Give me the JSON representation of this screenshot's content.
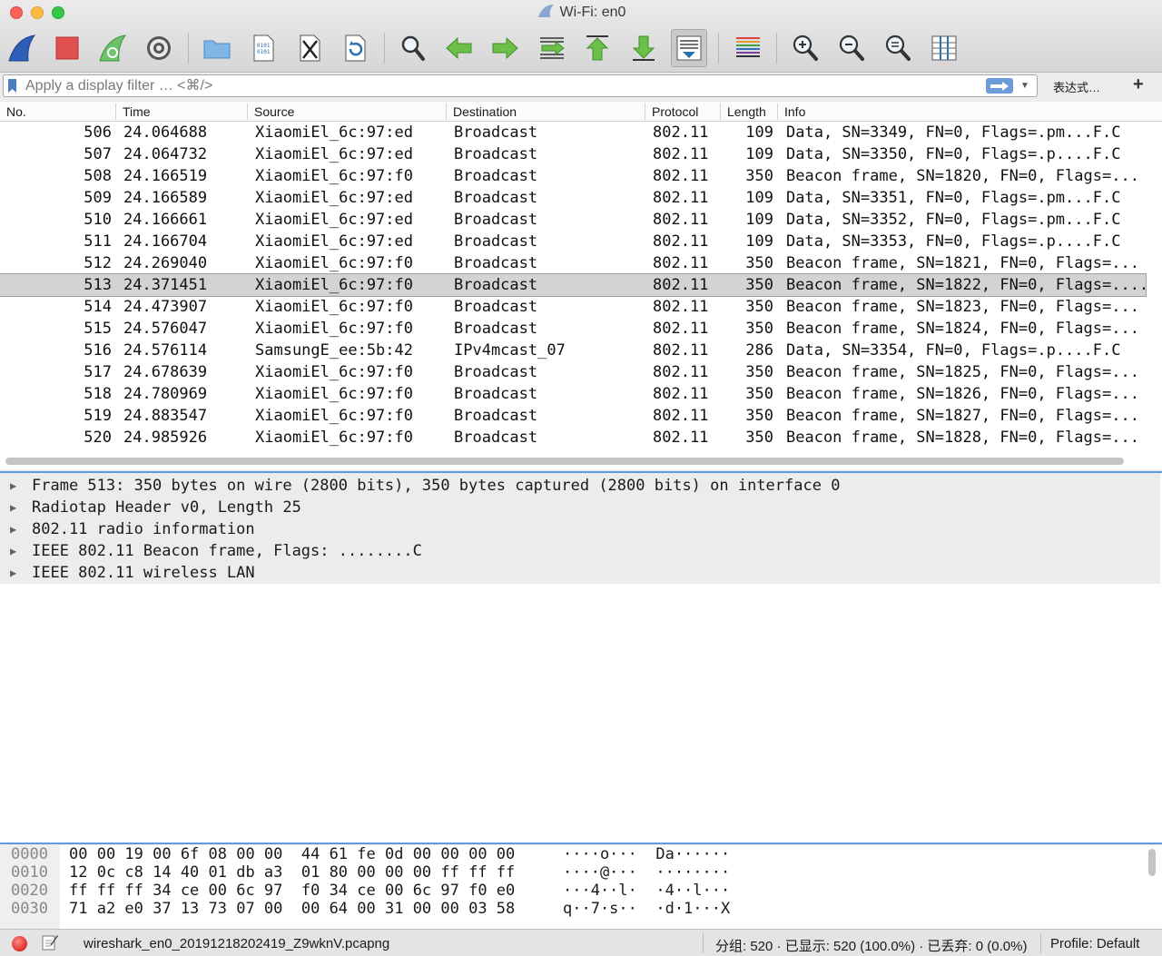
{
  "window": {
    "title": "Wi-Fi: en0"
  },
  "toolbar": {
    "buttons": [
      {
        "icon": "shark-fin-start-icon"
      },
      {
        "icon": "stop-square-icon"
      },
      {
        "icon": "restart-fin-icon"
      },
      {
        "icon": "options-gear-icon"
      },
      {
        "icon": "open-folder-icon"
      },
      {
        "icon": "save-file-icon"
      },
      {
        "icon": "close-file-icon"
      },
      {
        "icon": "reload-file-icon"
      },
      {
        "icon": "find-magnifier-icon"
      },
      {
        "icon": "go-back-arrow-icon"
      },
      {
        "icon": "go-forward-arrow-icon"
      },
      {
        "icon": "go-to-packet-icon"
      },
      {
        "icon": "go-first-packet-icon"
      },
      {
        "icon": "go-last-packet-icon"
      },
      {
        "icon": "autoscroll-icon"
      },
      {
        "icon": "colorize-icon"
      },
      {
        "icon": "zoom-in-icon"
      },
      {
        "icon": "zoom-out-icon"
      },
      {
        "icon": "normal-size-icon"
      },
      {
        "icon": "resize-columns-icon"
      }
    ]
  },
  "filter": {
    "placeholder": "Apply a display filter … <⌘/>",
    "value": "",
    "expression_label": "表达式…",
    "add_label": "+"
  },
  "packet_list": {
    "columns": [
      "No.",
      "Time",
      "Source",
      "Destination",
      "Protocol",
      "Length",
      "Info"
    ],
    "selected_index": 7,
    "rows": [
      {
        "no": "506",
        "time": "24.064688",
        "source": "XiaomiEl_6c:97:ed",
        "destination": "Broadcast",
        "protocol": "802.11",
        "length": "109",
        "info": "Data, SN=3349, FN=0, Flags=.pm...F.C"
      },
      {
        "no": "507",
        "time": "24.064732",
        "source": "XiaomiEl_6c:97:ed",
        "destination": "Broadcast",
        "protocol": "802.11",
        "length": "109",
        "info": "Data, SN=3350, FN=0, Flags=.p....F.C"
      },
      {
        "no": "508",
        "time": "24.166519",
        "source": "XiaomiEl_6c:97:f0",
        "destination": "Broadcast",
        "protocol": "802.11",
        "length": "350",
        "info": "Beacon frame, SN=1820, FN=0, Flags=..."
      },
      {
        "no": "509",
        "time": "24.166589",
        "source": "XiaomiEl_6c:97:ed",
        "destination": "Broadcast",
        "protocol": "802.11",
        "length": "109",
        "info": "Data, SN=3351, FN=0, Flags=.pm...F.C"
      },
      {
        "no": "510",
        "time": "24.166661",
        "source": "XiaomiEl_6c:97:ed",
        "destination": "Broadcast",
        "protocol": "802.11",
        "length": "109",
        "info": "Data, SN=3352, FN=0, Flags=.pm...F.C"
      },
      {
        "no": "511",
        "time": "24.166704",
        "source": "XiaomiEl_6c:97:ed",
        "destination": "Broadcast",
        "protocol": "802.11",
        "length": "109",
        "info": "Data, SN=3353, FN=0, Flags=.p....F.C"
      },
      {
        "no": "512",
        "time": "24.269040",
        "source": "XiaomiEl_6c:97:f0",
        "destination": "Broadcast",
        "protocol": "802.11",
        "length": "350",
        "info": "Beacon frame, SN=1821, FN=0, Flags=..."
      },
      {
        "no": "513",
        "time": "24.371451",
        "source": "XiaomiEl_6c:97:f0",
        "destination": "Broadcast",
        "protocol": "802.11",
        "length": "350",
        "info": "Beacon frame, SN=1822, FN=0, Flags=...."
      },
      {
        "no": "514",
        "time": "24.473907",
        "source": "XiaomiEl_6c:97:f0",
        "destination": "Broadcast",
        "protocol": "802.11",
        "length": "350",
        "info": "Beacon frame, SN=1823, FN=0, Flags=..."
      },
      {
        "no": "515",
        "time": "24.576047",
        "source": "XiaomiEl_6c:97:f0",
        "destination": "Broadcast",
        "protocol": "802.11",
        "length": "350",
        "info": "Beacon frame, SN=1824, FN=0, Flags=..."
      },
      {
        "no": "516",
        "time": "24.576114",
        "source": "SamsungE_ee:5b:42",
        "destination": "IPv4mcast_07",
        "protocol": "802.11",
        "length": "286",
        "info": "Data, SN=3354, FN=0, Flags=.p....F.C"
      },
      {
        "no": "517",
        "time": "24.678639",
        "source": "XiaomiEl_6c:97:f0",
        "destination": "Broadcast",
        "protocol": "802.11",
        "length": "350",
        "info": "Beacon frame, SN=1825, FN=0, Flags=..."
      },
      {
        "no": "518",
        "time": "24.780969",
        "source": "XiaomiEl_6c:97:f0",
        "destination": "Broadcast",
        "protocol": "802.11",
        "length": "350",
        "info": "Beacon frame, SN=1826, FN=0, Flags=..."
      },
      {
        "no": "519",
        "time": "24.883547",
        "source": "XiaomiEl_6c:97:f0",
        "destination": "Broadcast",
        "protocol": "802.11",
        "length": "350",
        "info": "Beacon frame, SN=1827, FN=0, Flags=..."
      },
      {
        "no": "520",
        "time": "24.985926",
        "source": "XiaomiEl_6c:97:f0",
        "destination": "Broadcast",
        "protocol": "802.11",
        "length": "350",
        "info": "Beacon frame, SN=1828, FN=0, Flags=..."
      }
    ]
  },
  "details": {
    "items": [
      "Frame 513: 350 bytes on wire (2800 bits), 350 bytes captured (2800 bits) on interface 0",
      "Radiotap Header v0, Length 25",
      "802.11 radio information",
      "IEEE 802.11 Beacon frame, Flags: ........C",
      "IEEE 802.11 wireless LAN"
    ]
  },
  "hex": {
    "rows": [
      {
        "offset": "0000",
        "bytes": "00 00 19 00 6f 08 00 00  44 61 fe 0d 00 00 00 00",
        "ascii": "····o···  Da······"
      },
      {
        "offset": "0010",
        "bytes": "12 0c c8 14 40 01 db a3  01 80 00 00 00 ff ff ff",
        "ascii": "····@···  ········"
      },
      {
        "offset": "0020",
        "bytes": "ff ff ff 34 ce 00 6c 97  f0 34 ce 00 6c 97 f0 e0",
        "ascii": "···4··l·  ·4··l···"
      },
      {
        "offset": "0030",
        "bytes": "71 a2 e0 37 13 73 07 00  00 64 00 31 00 00 03 58",
        "ascii": "q··7·s··  ·d·1···X"
      }
    ]
  },
  "status": {
    "file_name": "wireshark_en0_20191218202419_Z9wknV.pcapng",
    "stats": "分组: 520 · 已显示: 520 (100.0%) · 已丢弃: 0 (0.0%)",
    "profile": "Profile: Default"
  }
}
